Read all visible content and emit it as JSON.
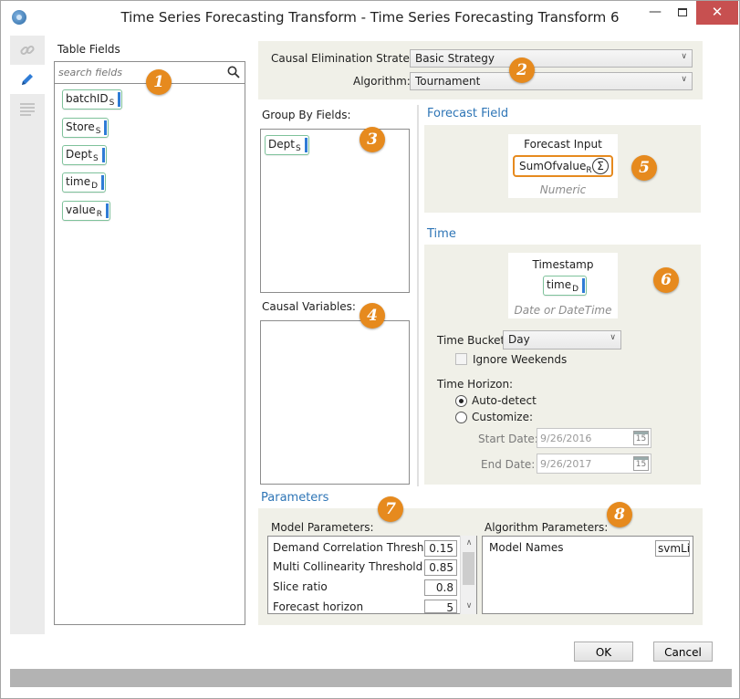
{
  "window": {
    "title": "Time Series Forecasting Transform - Time Series Forecasting Transform 6",
    "minimize_glyph": "—",
    "close_glyph": "✕"
  },
  "rail": {
    "items": [
      "link-icon",
      "pencil-icon",
      "list-icon"
    ],
    "active": "pencil-icon"
  },
  "table_fields": {
    "title": "Table Fields",
    "search_placeholder": "search fields",
    "fields": [
      {
        "name": "batchID",
        "type": "S"
      },
      {
        "name": "Store",
        "type": "S"
      },
      {
        "name": "Dept",
        "type": "S"
      },
      {
        "name": "time",
        "type": "D"
      },
      {
        "name": "value",
        "type": "R"
      }
    ]
  },
  "badges": [
    "1",
    "2",
    "3",
    "4",
    "5",
    "6",
    "7",
    "8"
  ],
  "strategy": {
    "causal_label": "Causal Elimination Strategy:",
    "causal_value": "Basic Strategy",
    "algorithm_label": "Algorithm:",
    "algorithm_value": "Tournament"
  },
  "group_by": {
    "title": "Group By Fields:",
    "fields": [
      {
        "name": "Dept",
        "type": "S"
      }
    ]
  },
  "causal_variables": {
    "title": "Causal Variables:"
  },
  "forecast_field": {
    "section_title": "Forecast Field",
    "card_title": "Forecast Input",
    "value_name": "SumOfvalue",
    "value_type": "R",
    "sigma": "Σ",
    "card_sub": "Numeric"
  },
  "time": {
    "section_title": "Time",
    "card_title": "Timestamp",
    "field_name": "time",
    "field_type": "D",
    "card_sub": "Date or DateTime",
    "bucket_label": "Time Bucket:",
    "bucket_value": "Day",
    "ignore_weekends": "Ignore Weekends",
    "horizon_label": "Time Horizon:",
    "auto_detect": "Auto-detect",
    "customize": "Customize:",
    "start_label": "Start Date:",
    "start_value": "9/26/2016",
    "end_label": "End Date:",
    "end_value": "9/26/2017",
    "calendar_day": "15"
  },
  "parameters": {
    "section_title": "Parameters",
    "model_title": "Model Parameters:",
    "model_rows": [
      {
        "name": "Demand Correlation Threshold",
        "value": "0.15"
      },
      {
        "name": "Multi Collinearity Threshold",
        "value": "0.85"
      },
      {
        "name": "Slice ratio",
        "value": "0.8"
      },
      {
        "name": "Forecast horizon",
        "value": "5"
      }
    ],
    "algorithm_title": "Algorithm Parameters:",
    "algorithm_rows": [
      {
        "name": "Model Names",
        "value": "svmLi"
      }
    ]
  },
  "footer": {
    "ok": "OK",
    "cancel": "Cancel"
  }
}
